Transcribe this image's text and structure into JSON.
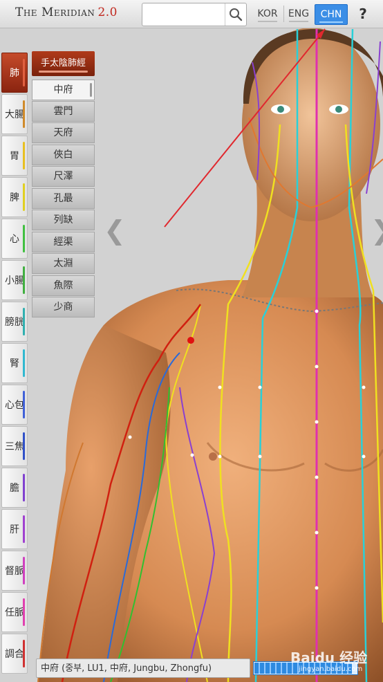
{
  "app": {
    "title_main": "The Meridian",
    "title_version": "2.0"
  },
  "search": {
    "placeholder": "",
    "value": ""
  },
  "languages": [
    {
      "label": "KOR",
      "active": false
    },
    {
      "label": "ENG",
      "active": false
    },
    {
      "label": "CHN",
      "active": true
    }
  ],
  "help_label": "?",
  "meridians": [
    {
      "label": "肺",
      "color": "#c8321c",
      "active": true
    },
    {
      "label": "大腸",
      "color": "#d08a2a"
    },
    {
      "label": "胃",
      "color": "#e8c020"
    },
    {
      "label": "脾",
      "color": "#e0d020"
    },
    {
      "label": "心",
      "color": "#40c040"
    },
    {
      "label": "小腸",
      "color": "#40b040"
    },
    {
      "label": "膀胱",
      "color": "#30b0b0"
    },
    {
      "label": "腎",
      "color": "#30b8d0"
    },
    {
      "label": "心包",
      "color": "#4060d8"
    },
    {
      "label": "三焦",
      "color": "#3050c8"
    },
    {
      "label": "膽",
      "color": "#8040d0"
    },
    {
      "label": "肝",
      "color": "#a040d0"
    },
    {
      "label": "督脈",
      "color": "#d040c0"
    },
    {
      "label": "任脈",
      "color": "#e040b0"
    },
    {
      "label": "調合",
      "color": "#d03030"
    }
  ],
  "point_list": {
    "title": "手太陰肺經",
    "items": [
      "中府",
      "雲門",
      "天府",
      "俠白",
      "尺澤",
      "孔最",
      "列缺",
      "經渠",
      "太淵",
      "魚際",
      "少商"
    ],
    "selected": "中府"
  },
  "status_text": "中府 (중부, LU1, 中府, Jungbu, Zhongfu)",
  "progress": 0.95,
  "watermark": {
    "main": "Baidu 经验",
    "sub": "jingyan.baidu.com"
  }
}
